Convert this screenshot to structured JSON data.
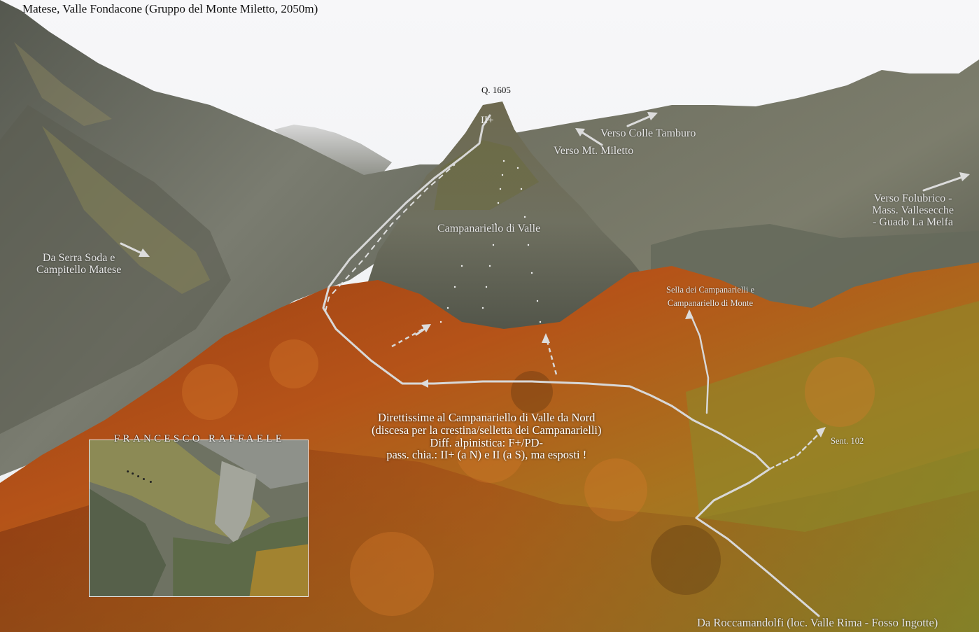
{
  "title": "Matese, Valle Fondacone (Gruppo del Monte Miletto, 2050m)",
  "labels": {
    "quota": "Q. 1605",
    "grade_summit": "II+",
    "verso_colle_tamburo": "Verso Colle Tamburo",
    "verso_mt_miletto": "Verso Mt. Miletto",
    "verso_folubrico": [
      "Verso Folubrico -",
      "Mass. Vallesecche",
      "- Guado La Melfa"
    ],
    "campanariello_valle": "Campanariello di Valle",
    "da_serra_soda": [
      "Da Serra Soda e",
      "Campitello Matese"
    ],
    "sella": [
      "Sella dei Campanarielli e",
      "Campanariello di Monte"
    ],
    "sentiero": "Sent. 102",
    "da_roccamandolfi": "Da Roccamandolfi (loc. Valle Rima - Fosso Ingotte)"
  },
  "route_note": [
    "Direttissime al Campanariello di Valle da Nord",
    "(discesa per la crestina/selletta dei Campanarielli)",
    "Diff. alpinistica: F+/PD-",
    "pass. chia.: II+ (a N) e II (a S), ma esposti !"
  ],
  "author": "FRANCESCO RAFFAELE",
  "colors": {
    "sky": "#f4f4f6",
    "rock": "#6f7268",
    "grass": "#8a8a48",
    "forest_orange": "#b8501a",
    "forest_yellow": "#c9a23a",
    "trail": "#d8d8d8"
  }
}
